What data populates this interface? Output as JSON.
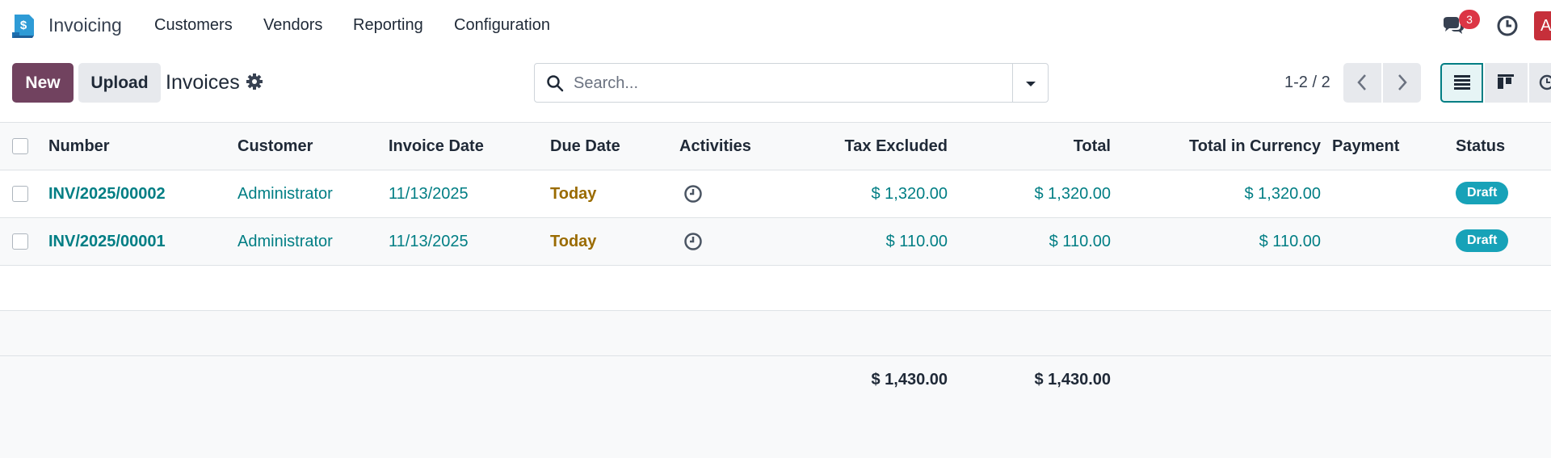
{
  "nav": {
    "app_name": "Invoicing",
    "menus": [
      "Customers",
      "Vendors",
      "Reporting",
      "Configuration"
    ],
    "messages_badge": "3",
    "avatar_letter": "A"
  },
  "control": {
    "new_label": "New",
    "upload_label": "Upload",
    "title": "Invoices",
    "search_placeholder": "Search...",
    "pager": "1-2 / 2"
  },
  "table": {
    "headers": {
      "number": "Number",
      "customer": "Customer",
      "invoice_date": "Invoice Date",
      "due_date": "Due Date",
      "activities": "Activities",
      "tax_excluded": "Tax Excluded",
      "total": "Total",
      "total_currency": "Total in Currency",
      "payment": "Payment",
      "status": "Status"
    },
    "rows": [
      {
        "number": "INV/2025/00002",
        "customer": "Administrator",
        "invoice_date": "11/13/2025",
        "due_date": "Today",
        "tax_excluded": "$ 1,320.00",
        "total": "$ 1,320.00",
        "total_currency": "$ 1,320.00",
        "status": "Draft"
      },
      {
        "number": "INV/2025/00001",
        "customer": "Administrator",
        "invoice_date": "11/13/2025",
        "due_date": "Today",
        "tax_excluded": "$ 110.00",
        "total": "$ 110.00",
        "total_currency": "$ 110.00",
        "status": "Draft"
      }
    ],
    "footer": {
      "tax_excluded": "$ 1,430.00",
      "total": "$ 1,430.00"
    }
  },
  "colors": {
    "brand": "#71425f",
    "link": "#017e84",
    "due": "#9a6b00",
    "badge_draft": "#17a2b8"
  }
}
